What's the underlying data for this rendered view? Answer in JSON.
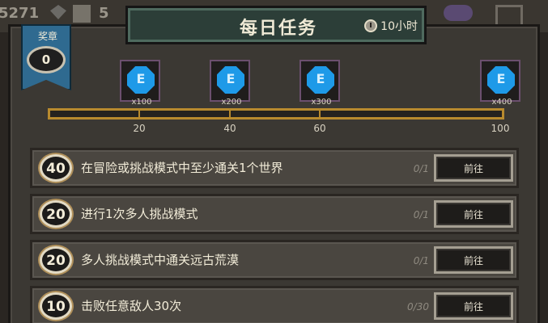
{
  "hud": {
    "left_value": "5271",
    "count": "5"
  },
  "header": {
    "title": "每日任务",
    "timer": "10小时"
  },
  "medal": {
    "label": "奖章",
    "value": "0"
  },
  "rewards": [
    {
      "qty": "x100",
      "icon": "blue-gem-icon"
    },
    {
      "qty": "x200",
      "icon": "blue-gem-icon"
    },
    {
      "qty": "x300",
      "icon": "blue-gem-icon"
    },
    {
      "qty": "x400",
      "icon": "blue-gem-icon"
    }
  ],
  "progress": {
    "value": 0,
    "max": 100,
    "ticks": [
      "20",
      "40",
      "60",
      "100"
    ]
  },
  "tasks": [
    {
      "points": "40",
      "text": "在冒险或挑战模式中至少通关1个世界",
      "progress": "0/1",
      "button": "前往"
    },
    {
      "points": "20",
      "text": "进行1次多人挑战模式",
      "progress": "0/1",
      "button": "前往"
    },
    {
      "points": "20",
      "text": "多人挑战模式中通关远古荒漠",
      "progress": "0/1",
      "button": "前往"
    },
    {
      "points": "10",
      "text": "击败任意敌人30次",
      "progress": "0/30",
      "button": "前往"
    }
  ],
  "colors": {
    "accent": "#e4b23a",
    "title_bg": "#2c3e38",
    "gem": "#1e9ae8"
  }
}
